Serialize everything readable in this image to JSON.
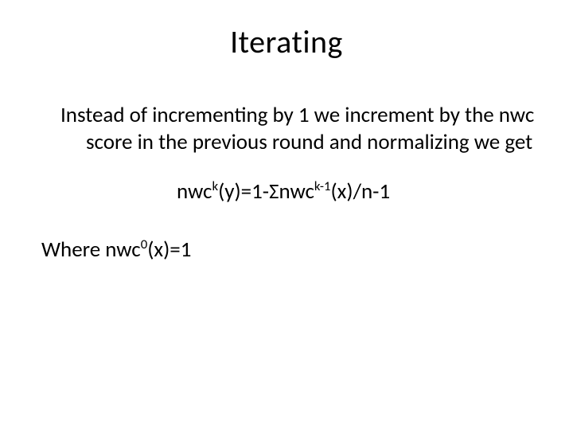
{
  "title": "Iterating",
  "paragraph": "Instead of incrementing by 1 we increment by the nwc score in the previous round and normalizing we get",
  "formula": {
    "lhs_base": "nwc",
    "lhs_sup": "k",
    "lhs_arg": "(y)=1-Σnwc",
    "rhs_sup": "k-1",
    "rhs_tail": "(x)/n-1"
  },
  "where": {
    "prefix": "Where nwc",
    "sup": "0",
    "suffix": "(x)=1"
  }
}
